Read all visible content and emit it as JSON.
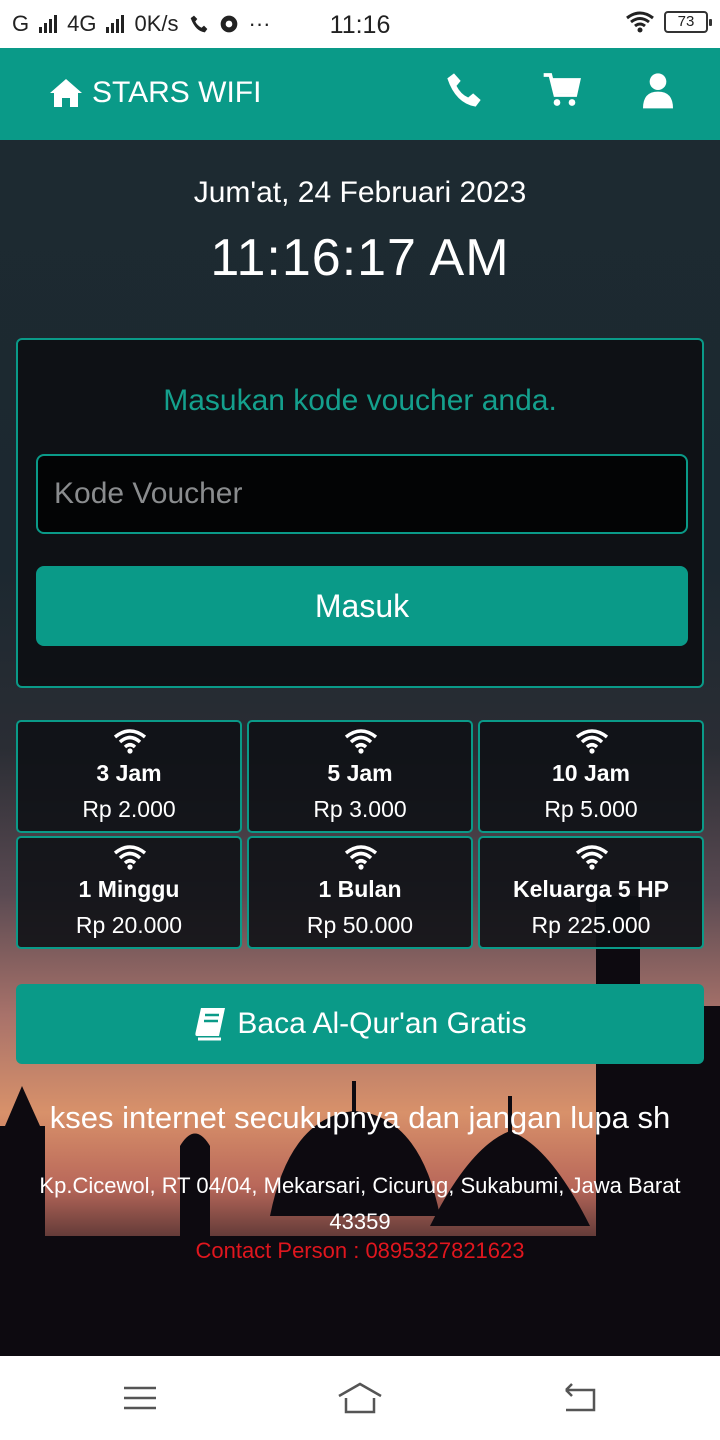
{
  "status_bar": {
    "carrier": "G",
    "network": "4G",
    "speed": "0K/s",
    "time": "11:16",
    "battery": "73"
  },
  "header": {
    "brand": "STARS WIFI",
    "icons": [
      "home-icon",
      "phone-icon",
      "cart-icon",
      "user-icon"
    ]
  },
  "main": {
    "date": "Jum'at, 24 Februari 2023",
    "clock": "11:16:17 AM"
  },
  "login": {
    "prompt": "Masukan kode voucher anda.",
    "voucher_value": "",
    "voucher_placeholder": "Kode Voucher",
    "submit_label": "Masuk"
  },
  "packages": [
    {
      "name": "3 Jam",
      "price": "Rp 2.000"
    },
    {
      "name": "5 Jam",
      "price": "Rp 3.000"
    },
    {
      "name": "10 Jam",
      "price": "Rp 5.000"
    },
    {
      "name": "1 Minggu",
      "price": "Rp 20.000"
    },
    {
      "name": "1 Bulan",
      "price": "Rp 50.000"
    },
    {
      "name": "Keluarga 5 HP",
      "price": "Rp 225.000"
    }
  ],
  "quran_button": {
    "label": "Baca Al-Qur'an Gratis",
    "icon": "book-icon"
  },
  "marquee": "kses internet secukupnya dan jangan lupa sh",
  "address": "Kp.Cicewol, RT 04/04, Mekarsari, Cicurug, Sukabumi, Jawa Barat 43359",
  "contact": "Contact Person : 0895327821623",
  "colors": {
    "accent": "#0a9a88",
    "contact": "#e0161e",
    "panel": "#0e1014"
  }
}
